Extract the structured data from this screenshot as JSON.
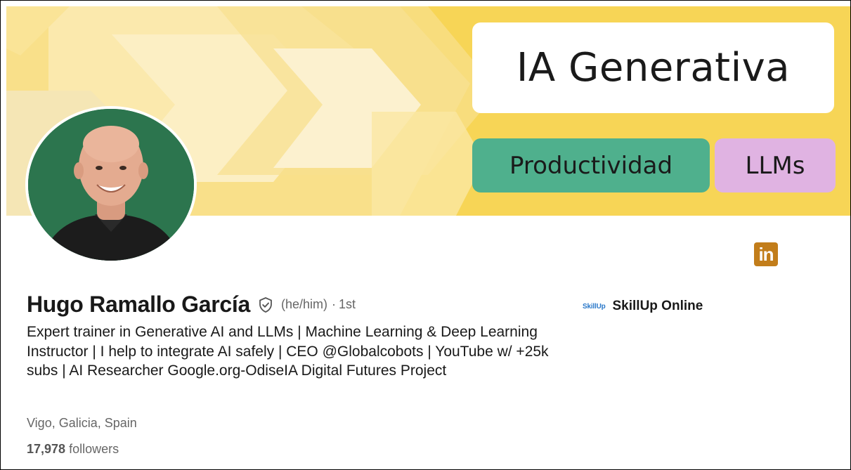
{
  "banner": {
    "headline_tag": "IA Generativa",
    "tags": [
      "Productividad",
      "LLMs"
    ],
    "colors": {
      "background": "#f7d556",
      "headline_tag_bg": "#ffffff",
      "tag_1_bg": "#4fb08d",
      "tag_2_bg": "#e0b3e2"
    }
  },
  "profile": {
    "name": "Hugo Ramallo García",
    "verified_icon": "shield-check-icon",
    "pronouns": "(he/him)",
    "separator": "·",
    "connection_degree": "1st",
    "headline": "Expert trainer in Generative AI and LLMs | Machine Learning & Deep Learning Instructor | I help to integrate AI safely | CEO @Globalcobots | YouTube w/ +25k subs | AI Researcher Google.org-OdiseIA Digital Futures Project",
    "location": "Vigo, Galicia, Spain",
    "followers_count": "17,978",
    "followers_label": "followers"
  },
  "company": {
    "logo_text": "SkillUp",
    "name": "SkillUp Online"
  },
  "icons": {
    "linkedin": "linkedin-icon",
    "linkedin_glyph": "in",
    "linkedin_color": "#c27d1a"
  }
}
